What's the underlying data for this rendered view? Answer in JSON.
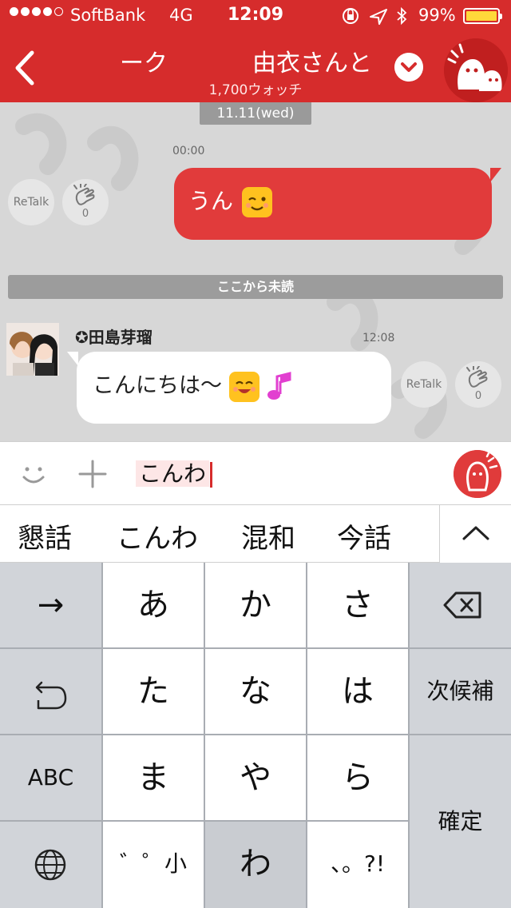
{
  "status_bar": {
    "carrier": "SoftBank",
    "network": "4G",
    "time": "12:09",
    "battery_percent": "99%",
    "battery_level": 0.99,
    "signal_bars": 4
  },
  "header": {
    "title_left": "ーク",
    "title_right": "由衣さんと",
    "watch_count": "1,700ウォッチ",
    "accent_color": "#d62c2c"
  },
  "chat": {
    "date_label": "11.11(wed)",
    "sent_message": {
      "time": "00:00",
      "text": "うん",
      "retalk_label": "ReTalk",
      "clap_count": "0"
    },
    "unread_divider": "ここから未読",
    "received_message": {
      "sender": "✪田島芽瑠",
      "time": "12:08",
      "text": "こんにちは〜",
      "retalk_label": "ReTalk",
      "clap_count": "0"
    }
  },
  "input": {
    "composing_text": "こんわ"
  },
  "candidates": [
    "懇話",
    "こんわ",
    "混和",
    "今話"
  ],
  "keyboard": {
    "row1": [
      "→",
      "あ",
      "か",
      "さ"
    ],
    "row2": [
      "た",
      "な",
      "は"
    ],
    "next_candidate": "次候補",
    "row3": [
      "ABC",
      "ま",
      "や",
      "ら"
    ],
    "confirm": "確定",
    "row4": [
      "゛゜小",
      "わ",
      "、。?!"
    ]
  }
}
